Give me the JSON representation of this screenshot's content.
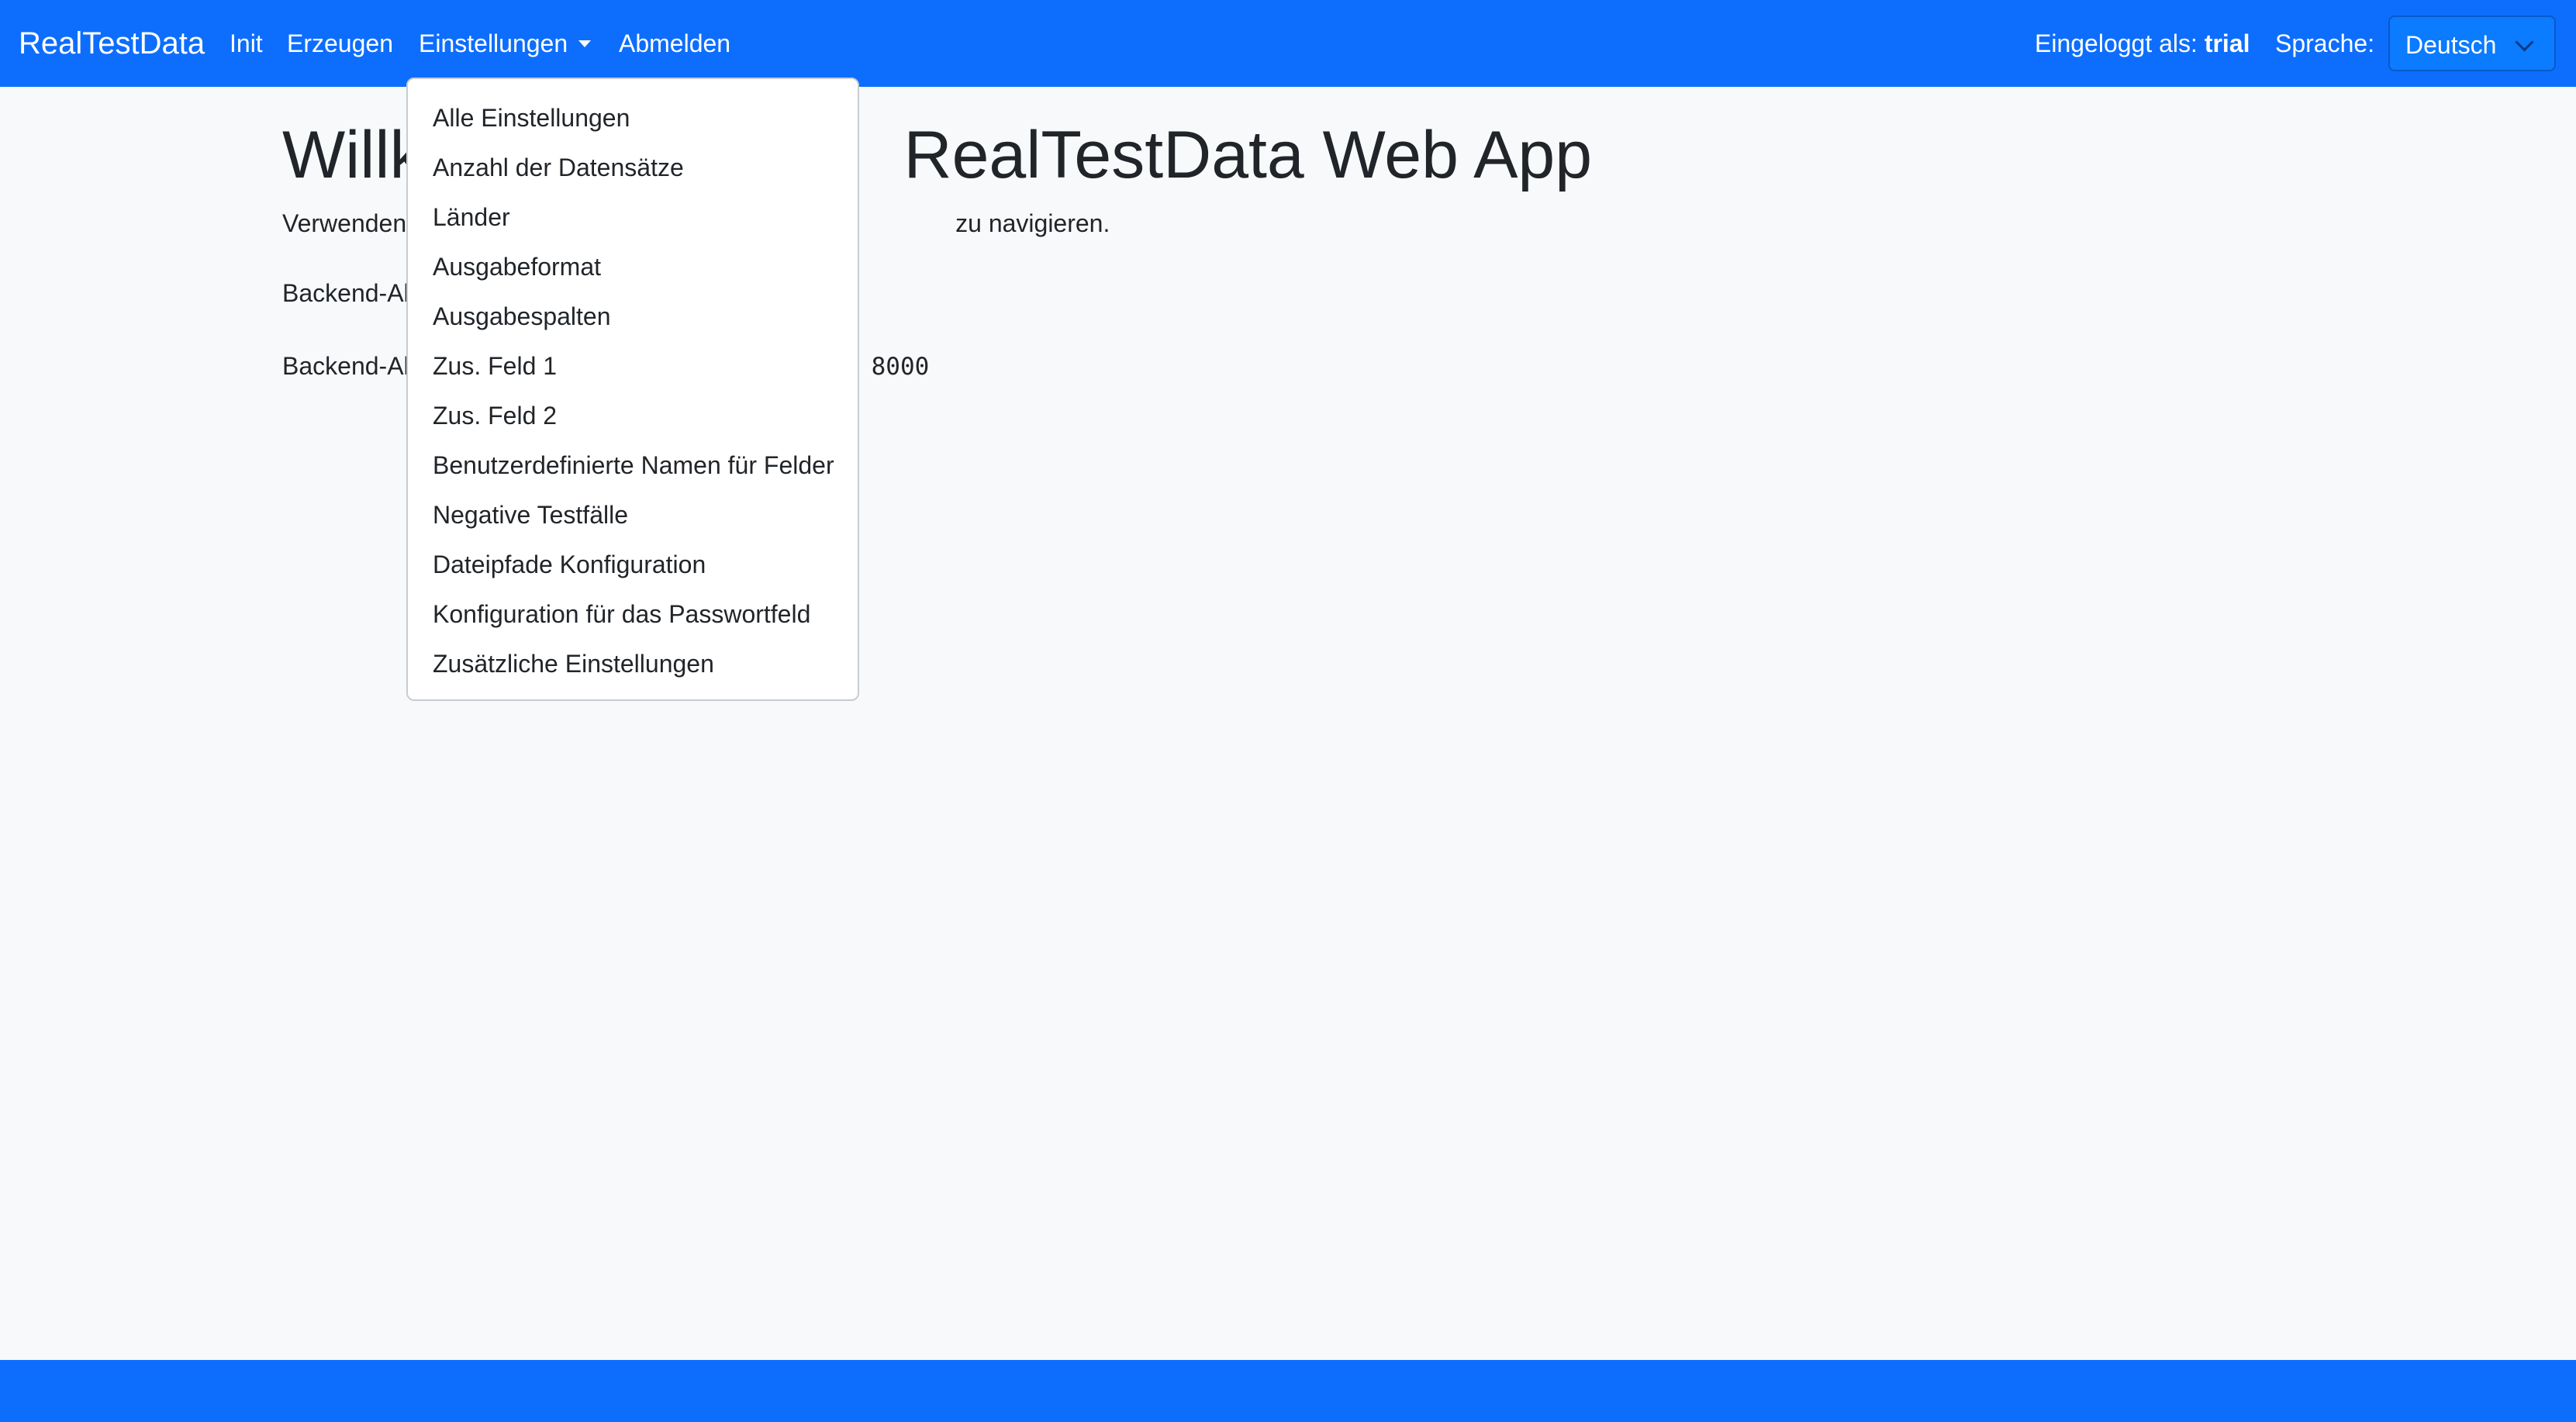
{
  "navbar": {
    "brand": "RealTestData",
    "links": {
      "init": "Init",
      "erzeugen": "Erzeugen",
      "einstellungen": "Einstellungen",
      "abmelden": "Abmelden"
    },
    "logged_in_label": "Eingeloggt als:",
    "logged_in_user": "trial",
    "language_label": "Sprache:",
    "language_value": "Deutsch"
  },
  "main": {
    "title_left": "Willk",
    "title_right": "RealTestData Web App",
    "p1_left": "Verwenden",
    "p1_right": "zu navigieren.",
    "p2_left": "Backend-Al",
    "p3_left": "Backend-Al",
    "p3_right": "8000"
  },
  "dropdown": {
    "items": [
      "Alle Einstellungen",
      "Anzahl der Datensätze",
      "Länder",
      "Ausgabeformat",
      "Ausgabespalten",
      "Zus. Feld 1",
      "Zus. Feld 2",
      "Benutzerdefinierte Namen für Felder",
      "Negative Testfälle",
      "Dateipfade Konfiguration",
      "Konfiguration für das Passwortfeld",
      "Zusätzliche Einstellungen"
    ]
  },
  "colors": {
    "navbar_bg": "#0d6efd",
    "page_bg": "#f8f9fa",
    "text": "#212529",
    "footer_bg": "#0d6efd"
  },
  "icons": {
    "dropdown_caret": "caret-down-icon",
    "select_chevron": "chevron-down-icon"
  }
}
